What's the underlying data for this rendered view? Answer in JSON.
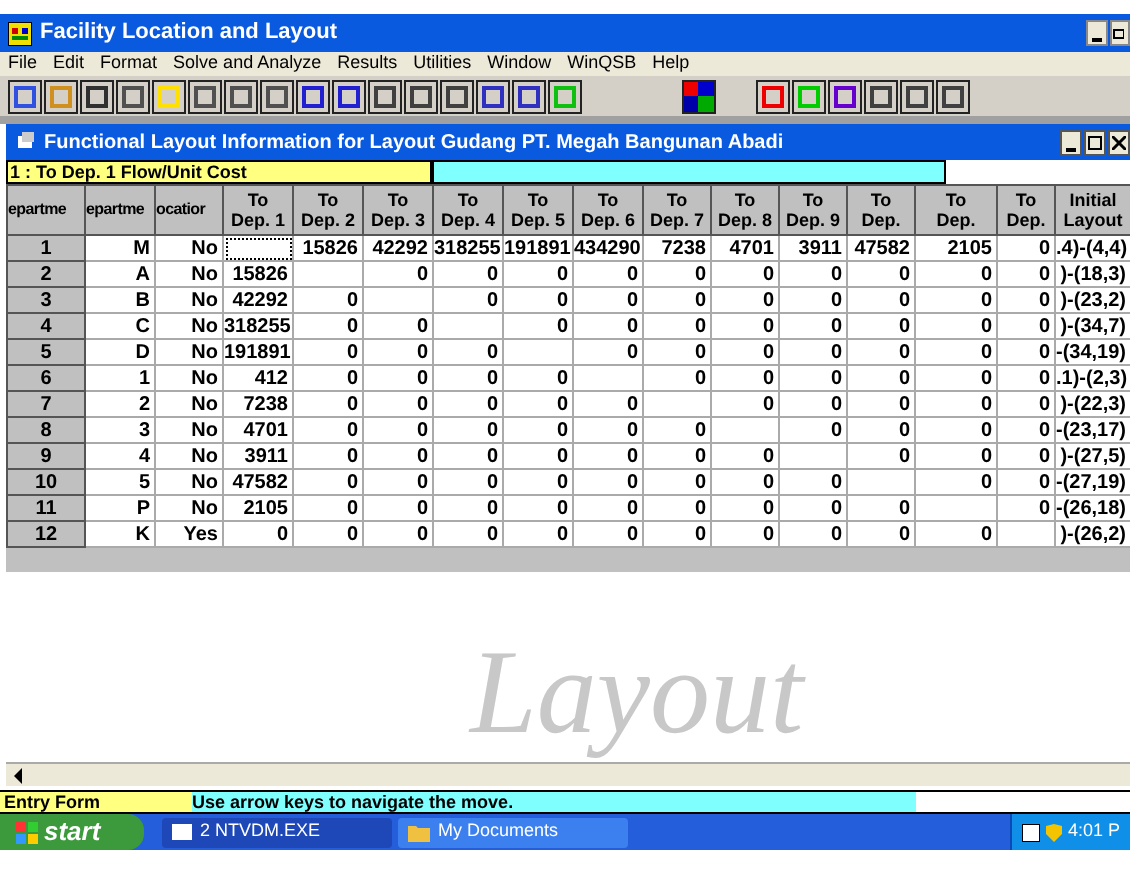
{
  "window": {
    "title": "Facility Location and Layout"
  },
  "menu": [
    "File",
    "Edit",
    "Format",
    "Solve and Analyze",
    "Results",
    "Utilities",
    "Window",
    "WinQSB",
    "Help"
  ],
  "child_window": {
    "title": "Functional Layout Information for Layout Gudang PT. Megah Bangunan Abadi",
    "cell_indicator": "1 : To Dep. 1 Flow/Unit Cost",
    "columns": [
      "epartme",
      "epartme",
      "ocatior",
      "To\nDep. 1",
      "To\nDep. 2",
      "To\nDep. 3",
      "To\nDep. 4",
      "To\nDep. 5",
      "To\nDep. 6",
      "To\nDep. 7",
      "To\nDep. 8",
      "To\nDep. 9",
      "To\nDep.",
      "To\nDep.",
      "To\nDep.",
      "Initial\nLayout"
    ],
    "rows": [
      {
        "focus": true,
        "cells": [
          "1",
          "M",
          "No",
          null,
          "15826",
          "42292",
          "318255",
          "191891",
          "434290",
          "7238",
          "4701",
          "3911",
          "47582",
          "2105",
          "0",
          ".4)-(4,4)"
        ]
      },
      {
        "focus": false,
        "cells": [
          "2",
          "A",
          "No",
          "15826",
          null,
          "0",
          "0",
          "0",
          "0",
          "0",
          "0",
          "0",
          "0",
          "0",
          "0",
          ")-(18,3)"
        ]
      },
      {
        "focus": false,
        "cells": [
          "3",
          "B",
          "No",
          "42292",
          "0",
          null,
          "0",
          "0",
          "0",
          "0",
          "0",
          "0",
          "0",
          "0",
          "0",
          ")-(23,2)"
        ]
      },
      {
        "focus": false,
        "cells": [
          "4",
          "C",
          "No",
          "318255",
          "0",
          "0",
          null,
          "0",
          "0",
          "0",
          "0",
          "0",
          "0",
          "0",
          "0",
          ")-(34,7)"
        ]
      },
      {
        "focus": false,
        "cells": [
          "5",
          "D",
          "No",
          "191891",
          "0",
          "0",
          "0",
          null,
          "0",
          "0",
          "0",
          "0",
          "0",
          "0",
          "0",
          "-(34,19)"
        ]
      },
      {
        "focus": false,
        "cells": [
          "6",
          "1",
          "No",
          "412",
          "0",
          "0",
          "0",
          "0",
          null,
          "0",
          "0",
          "0",
          "0",
          "0",
          "0",
          ".1)-(2,3)"
        ]
      },
      {
        "focus": false,
        "cells": [
          "7",
          "2",
          "No",
          "7238",
          "0",
          "0",
          "0",
          "0",
          "0",
          null,
          "0",
          "0",
          "0",
          "0",
          "0",
          ")-(22,3)"
        ]
      },
      {
        "focus": false,
        "cells": [
          "8",
          "3",
          "No",
          "4701",
          "0",
          "0",
          "0",
          "0",
          "0",
          "0",
          null,
          "0",
          "0",
          "0",
          "0",
          "-(23,17)"
        ]
      },
      {
        "focus": false,
        "cells": [
          "9",
          "4",
          "No",
          "3911",
          "0",
          "0",
          "0",
          "0",
          "0",
          "0",
          "0",
          null,
          "0",
          "0",
          "0",
          ")-(27,5)"
        ]
      },
      {
        "focus": false,
        "cells": [
          "10",
          "5",
          "No",
          "47582",
          "0",
          "0",
          "0",
          "0",
          "0",
          "0",
          "0",
          "0",
          null,
          "0",
          "0",
          "-(27,19)"
        ]
      },
      {
        "focus": false,
        "cells": [
          "11",
          "P",
          "No",
          "2105",
          "0",
          "0",
          "0",
          "0",
          "0",
          "0",
          "0",
          "0",
          "0",
          null,
          "0",
          "-(26,18)"
        ]
      },
      {
        "focus": false,
        "cells": [
          "12",
          "K",
          "Yes",
          "0",
          "0",
          "0",
          "0",
          "0",
          "0",
          "0",
          "0",
          "0",
          "0",
          "0",
          null,
          ")-(26,2)"
        ]
      }
    ],
    "background_text": "Layout"
  },
  "status_bar": {
    "label": "Entry Form",
    "message": "Use arrow keys to navigate the move."
  },
  "taskbar": {
    "start": "start",
    "tasks": [
      {
        "label": "2 NTVDM.EXE",
        "selected": true
      },
      {
        "label": "My Documents",
        "selected": false
      }
    ],
    "clock": "4:01 P"
  }
}
